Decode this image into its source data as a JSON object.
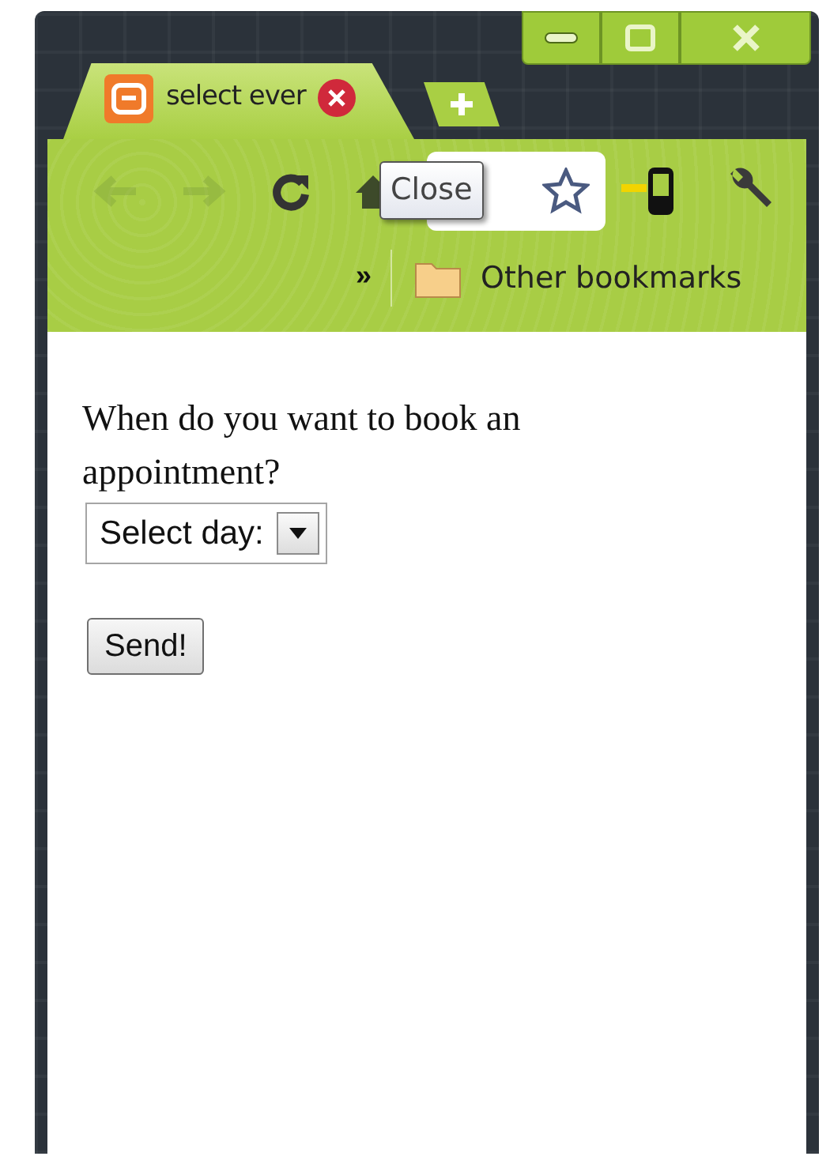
{
  "tabs": [
    {
      "title": "select ever",
      "selected": true
    }
  ],
  "toolbar": {
    "back": {
      "disabled": true
    },
    "forward": {
      "disabled": true
    }
  },
  "tooltip": "Close",
  "bookmarks_bar": {
    "overflow": "»",
    "items": [
      {
        "label": "Other bookmarks"
      }
    ]
  },
  "page": {
    "question": "When do you want to book an appointment?",
    "select": {
      "value": "Select day:"
    },
    "submit": "Send!"
  }
}
